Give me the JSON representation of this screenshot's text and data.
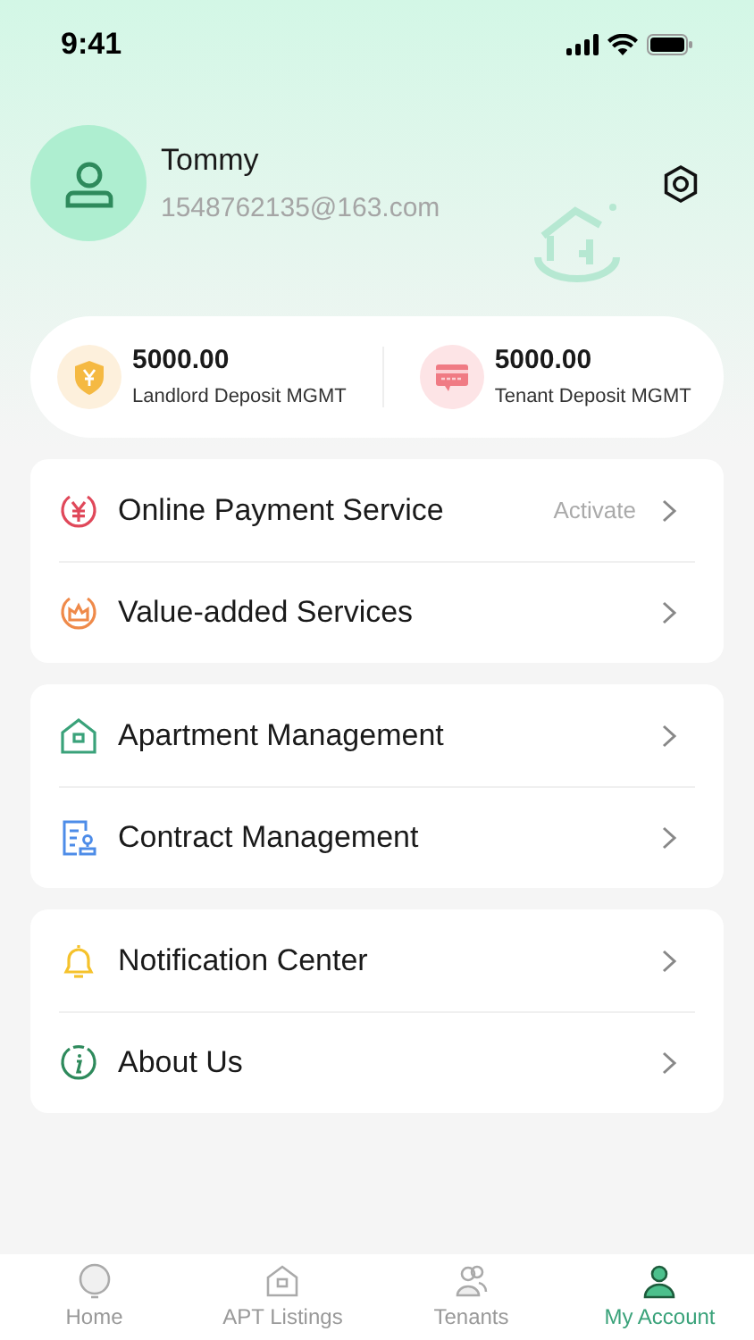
{
  "status_bar": {
    "time": "9:41"
  },
  "profile": {
    "name": "Tommy",
    "email": "1548762135@163.com"
  },
  "deposits": [
    {
      "amount": "5000.00",
      "label": "Landlord Deposit MGMT"
    },
    {
      "amount": "5000.00",
      "label": "Tenant Deposit MGMT"
    }
  ],
  "menu_groups": [
    {
      "items": [
        {
          "label": "Online Payment Service",
          "value": "Activate"
        },
        {
          "label": "Value-added Services"
        }
      ]
    },
    {
      "items": [
        {
          "label": "Apartment Management"
        },
        {
          "label": "Contract Management"
        }
      ]
    },
    {
      "items": [
        {
          "label": "Notification Center"
        },
        {
          "label": "About Us"
        }
      ]
    }
  ],
  "tab_bar": [
    {
      "label": "Home",
      "selected": false
    },
    {
      "label": "APT Listings",
      "selected": false
    },
    {
      "label": "Tenants",
      "selected": false
    },
    {
      "label": "My Account",
      "selected": true
    }
  ]
}
